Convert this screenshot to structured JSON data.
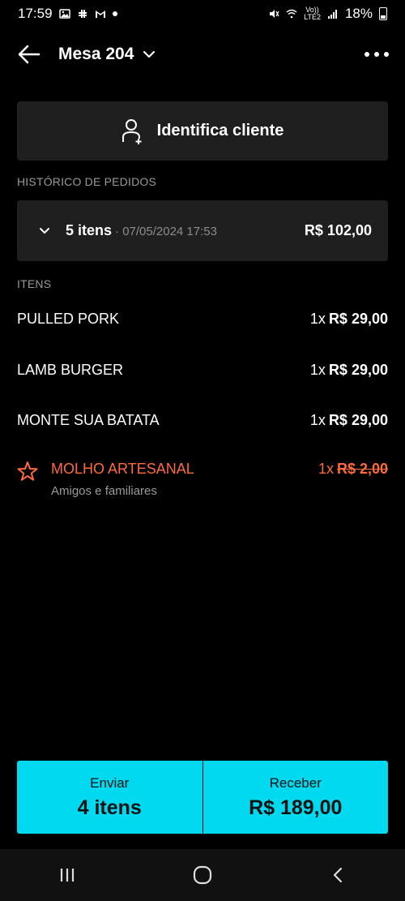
{
  "status_bar": {
    "time": "17:59",
    "battery": "18%",
    "lte_label": "Vo))\nLTE2"
  },
  "header": {
    "title": "Mesa 204",
    "icons": [
      "back-arrow-icon",
      "chevron-down-icon",
      "more-vert-icon"
    ]
  },
  "identify": {
    "label": "Identifica cliente",
    "icon": "user-add-icon"
  },
  "history": {
    "section_label": "HISTÓRICO DE PEDIDOS",
    "count": "5 itens",
    "date": "· 07/05/2024 17:53",
    "total": "R$ 102,00"
  },
  "items_section": {
    "label": "ITENS",
    "items": [
      {
        "name": "PULLED PORK",
        "qty": "1x",
        "price": "R$ 29,00"
      },
      {
        "name": "LAMB BURGER",
        "qty": "1x",
        "price": "R$ 29,00"
      },
      {
        "name": "MONTE SUA BATATA",
        "qty": "1x",
        "price": "R$ 29,00"
      }
    ],
    "favorite_item": {
      "name": "MOLHO ARTESANAL",
      "subtitle": "Amigos e familiares",
      "qty": "1x",
      "price": "R$ 2,00"
    }
  },
  "bottom_actions": {
    "send_top": "Enviar",
    "send_bottom": "4 itens",
    "receive_top": "Receber",
    "receive_bottom": "R$ 189,00"
  },
  "colors": {
    "accent": "#00d9ef",
    "highlight": "#ff6a3d",
    "card": "#1f1f1f"
  }
}
